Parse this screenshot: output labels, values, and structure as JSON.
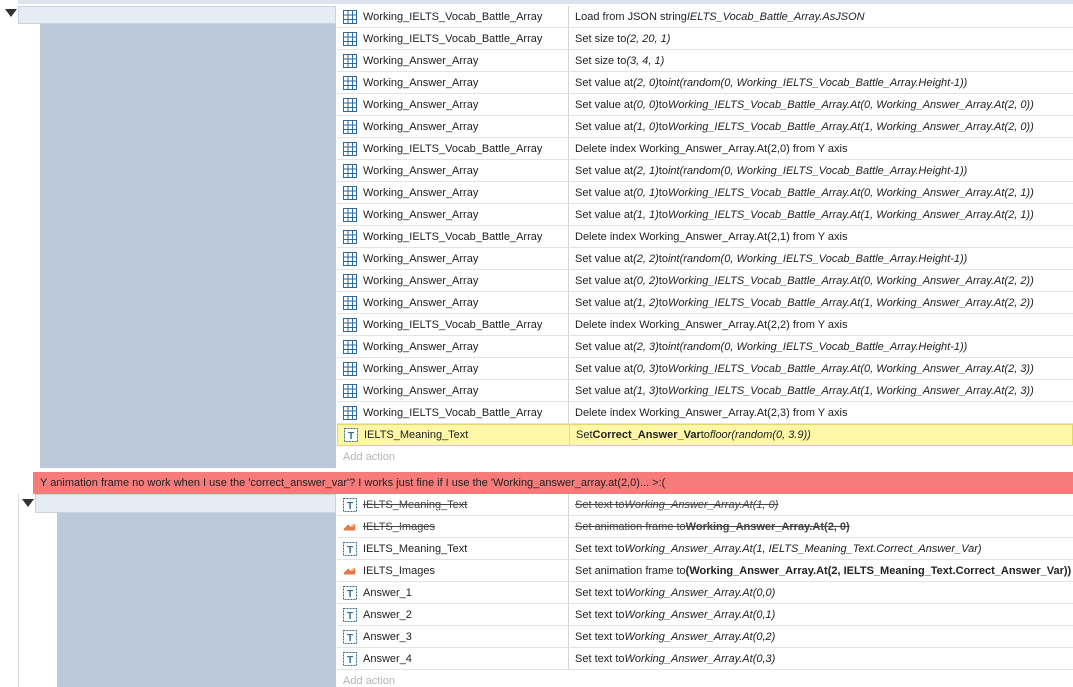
{
  "event1": {
    "rows": [
      {
        "icon": "array-icon",
        "object": "Working_IELTS_Vocab_Battle_Array",
        "action": [
          {
            "t": "Load from JSON string "
          },
          {
            "t": "IELTS_Vocab_Battle_Array.AsJSON",
            "i": true
          }
        ]
      },
      {
        "icon": "array-icon",
        "object": "Working_IELTS_Vocab_Battle_Array",
        "action": [
          {
            "t": "Set size to "
          },
          {
            "t": "(2, 20, 1)",
            "i": true
          }
        ]
      },
      {
        "icon": "array-icon",
        "object": "Working_Answer_Array",
        "action": [
          {
            "t": "Set size to "
          },
          {
            "t": "(3, 4, 1)",
            "i": true
          }
        ]
      },
      {
        "icon": "array-icon",
        "object": "Working_Answer_Array",
        "action": [
          {
            "t": "Set value at "
          },
          {
            "t": "(2, 0)",
            "i": true
          },
          {
            "t": " to "
          },
          {
            "t": "int(random(0, Working_IELTS_Vocab_Battle_Array.Height-1))",
            "i": true
          }
        ]
      },
      {
        "icon": "array-icon",
        "object": "Working_Answer_Array",
        "action": [
          {
            "t": "Set value at "
          },
          {
            "t": "(0, 0)",
            "i": true
          },
          {
            "t": " to "
          },
          {
            "t": "Working_IELTS_Vocab_Battle_Array.At(0, Working_Answer_Array.At(2, 0))",
            "i": true
          }
        ]
      },
      {
        "icon": "array-icon",
        "object": "Working_Answer_Array",
        "action": [
          {
            "t": "Set value at "
          },
          {
            "t": "(1, 0)",
            "i": true
          },
          {
            "t": " to "
          },
          {
            "t": "Working_IELTS_Vocab_Battle_Array.At(1, Working_Answer_Array.At(2, 0))",
            "i": true
          }
        ]
      },
      {
        "icon": "array-icon",
        "object": "Working_IELTS_Vocab_Battle_Array",
        "action": [
          {
            "t": "Delete index Working_Answer_Array.At(2,0) from Y axis"
          }
        ]
      },
      {
        "icon": "array-icon",
        "object": "Working_Answer_Array",
        "action": [
          {
            "t": "Set value at "
          },
          {
            "t": "(2, 1)",
            "i": true
          },
          {
            "t": " to "
          },
          {
            "t": "int(random(0, Working_IELTS_Vocab_Battle_Array.Height-1))",
            "i": true
          }
        ]
      },
      {
        "icon": "array-icon",
        "object": "Working_Answer_Array",
        "action": [
          {
            "t": "Set value at "
          },
          {
            "t": "(0, 1)",
            "i": true
          },
          {
            "t": " to "
          },
          {
            "t": "Working_IELTS_Vocab_Battle_Array.At(0, Working_Answer_Array.At(2, 1))",
            "i": true
          }
        ]
      },
      {
        "icon": "array-icon",
        "object": "Working_Answer_Array",
        "action": [
          {
            "t": "Set value at "
          },
          {
            "t": "(1, 1)",
            "i": true
          },
          {
            "t": " to "
          },
          {
            "t": "Working_IELTS_Vocab_Battle_Array.At(1, Working_Answer_Array.At(2, 1))",
            "i": true
          }
        ]
      },
      {
        "icon": "array-icon",
        "object": "Working_IELTS_Vocab_Battle_Array",
        "action": [
          {
            "t": "Delete index Working_Answer_Array.At(2,1) from Y axis"
          }
        ]
      },
      {
        "icon": "array-icon",
        "object": "Working_Answer_Array",
        "action": [
          {
            "t": "Set value at "
          },
          {
            "t": "(2, 2)",
            "i": true
          },
          {
            "t": " to "
          },
          {
            "t": "int(random(0, Working_IELTS_Vocab_Battle_Array.Height-1))",
            "i": true
          }
        ]
      },
      {
        "icon": "array-icon",
        "object": "Working_Answer_Array",
        "action": [
          {
            "t": "Set value at "
          },
          {
            "t": "(0, 2)",
            "i": true
          },
          {
            "t": " to "
          },
          {
            "t": "Working_IELTS_Vocab_Battle_Array.At(0, Working_Answer_Array.At(2, 2))",
            "i": true
          }
        ]
      },
      {
        "icon": "array-icon",
        "object": "Working_Answer_Array",
        "action": [
          {
            "t": "Set value at "
          },
          {
            "t": "(1, 2)",
            "i": true
          },
          {
            "t": " to "
          },
          {
            "t": "Working_IELTS_Vocab_Battle_Array.At(1, Working_Answer_Array.At(2, 2))",
            "i": true
          }
        ]
      },
      {
        "icon": "array-icon",
        "object": "Working_IELTS_Vocab_Battle_Array",
        "action": [
          {
            "t": "Delete index Working_Answer_Array.At(2,2) from Y axis"
          }
        ]
      },
      {
        "icon": "array-icon",
        "object": "Working_Answer_Array",
        "action": [
          {
            "t": "Set value at "
          },
          {
            "t": "(2, 3)",
            "i": true
          },
          {
            "t": " to "
          },
          {
            "t": "int(random(0, Working_IELTS_Vocab_Battle_Array.Height-1))",
            "i": true
          }
        ]
      },
      {
        "icon": "array-icon",
        "object": "Working_Answer_Array",
        "action": [
          {
            "t": "Set value at "
          },
          {
            "t": "(0, 3)",
            "i": true
          },
          {
            "t": " to "
          },
          {
            "t": "Working_IELTS_Vocab_Battle_Array.At(0, Working_Answer_Array.At(2, 3))",
            "i": true
          }
        ]
      },
      {
        "icon": "array-icon",
        "object": "Working_Answer_Array",
        "action": [
          {
            "t": "Set value at "
          },
          {
            "t": "(1, 3)",
            "i": true
          },
          {
            "t": " to "
          },
          {
            "t": "Working_IELTS_Vocab_Battle_Array.At(1, Working_Answer_Array.At(2, 3))",
            "i": true
          }
        ]
      },
      {
        "icon": "array-icon",
        "object": "Working_IELTS_Vocab_Battle_Array",
        "action": [
          {
            "t": "Delete index Working_Answer_Array.At(2,3) from Y axis"
          }
        ]
      },
      {
        "icon": "text-icon",
        "object": "IELTS_Meaning_Text",
        "highlight": true,
        "action": [
          {
            "t": "Set "
          },
          {
            "t": "Correct_Answer_Var",
            "b": true
          },
          {
            "t": " to "
          },
          {
            "t": "floor(random(0, 3.9))",
            "i": true
          }
        ]
      }
    ],
    "add_action": "Add action"
  },
  "comment": "Y animation frame no work when I use the 'correct_answer_var'? I works just fine if I use the 'Working_answer_array.at(2,0)...      >:(",
  "event2": {
    "rows": [
      {
        "icon": "text-icon",
        "object": "IELTS_Meaning_Text",
        "disabled": true,
        "action": [
          {
            "t": "Set text to "
          },
          {
            "t": "Working_Answer_Array.At(1, 0)",
            "i": true
          }
        ]
      },
      {
        "icon": "sprite-icon",
        "object": "IELTS_Images",
        "disabled": true,
        "action": [
          {
            "t": "Set animation frame to "
          },
          {
            "t": "Working_Answer_Array.At(2, 0)",
            "b": true
          }
        ]
      },
      {
        "icon": "text-icon",
        "object": "IELTS_Meaning_Text",
        "action": [
          {
            "t": "Set text to "
          },
          {
            "t": "Working_Answer_Array.At(1, IELTS_Meaning_Text.Correct_Answer_Var)",
            "i": true
          }
        ]
      },
      {
        "icon": "sprite-icon",
        "object": "IELTS_Images",
        "action": [
          {
            "t": "Set animation frame to "
          },
          {
            "t": "(Working_Answer_Array.At(2, IELTS_Meaning_Text.Correct_Answer_Var))",
            "b": true
          }
        ]
      },
      {
        "icon": "text-icon",
        "object": "Answer_1",
        "action": [
          {
            "t": "Set text to "
          },
          {
            "t": "Working_Answer_Array.At(0,0)",
            "i": true
          }
        ]
      },
      {
        "icon": "text-icon",
        "object": "Answer_2",
        "action": [
          {
            "t": "Set text to "
          },
          {
            "t": "Working_Answer_Array.At(0,1)",
            "i": true
          }
        ]
      },
      {
        "icon": "text-icon",
        "object": "Answer_3",
        "action": [
          {
            "t": "Set text to "
          },
          {
            "t": "Working_Answer_Array.At(0,2)",
            "i": true
          }
        ]
      },
      {
        "icon": "text-icon",
        "object": "Answer_4",
        "action": [
          {
            "t": "Set text to "
          },
          {
            "t": "Working_Answer_Array.At(0,3)",
            "i": true
          }
        ]
      }
    ],
    "add_action": "Add action"
  },
  "colors": {
    "comment_bg": "#f77b7b",
    "highlight_bg": "#fff7a8",
    "condition_col": "#bcc9db",
    "array_icon": "#2a6aa0",
    "text_icon": "#2f6e8c",
    "sprite_icon": "#e07a4a"
  }
}
